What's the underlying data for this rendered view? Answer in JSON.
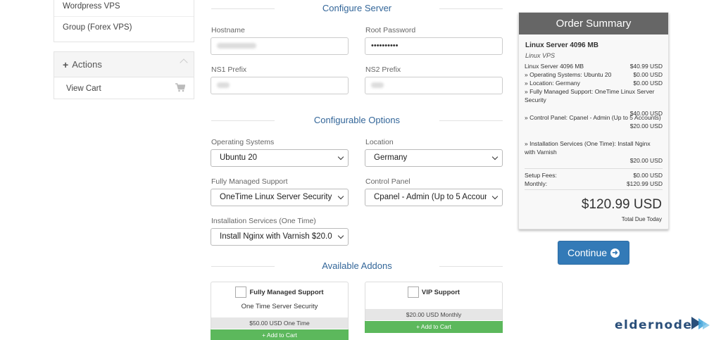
{
  "sidebar": {
    "items": [
      {
        "label": "Wordpress VPS"
      },
      {
        "label": "Group (Forex VPS)"
      }
    ],
    "actions": {
      "title": "Actions",
      "view_cart": "View Cart"
    }
  },
  "configure_server": {
    "title": "Configure Server",
    "hostname_label": "Hostname",
    "root_password_label": "Root Password",
    "root_password_value": "••••••••••",
    "ns1_label": "NS1 Prefix",
    "ns2_label": "NS2 Prefix"
  },
  "configurable_options": {
    "title": "Configurable Options",
    "os_label": "Operating Systems",
    "os_value": "Ubuntu 20",
    "location_label": "Location",
    "location_value": "Germany",
    "support_label": "Fully Managed Support",
    "support_value": "OneTime Linux Server Security $",
    "panel_label": "Control Panel",
    "panel_value": "Cpanel - Admin (Up to 5 Accoun",
    "install_label": "Installation Services (One Time)",
    "install_value": "Install Nginx with Varnish $20.0("
  },
  "addons": {
    "title": "Available Addons",
    "items": [
      {
        "name": "Fully Managed Support",
        "desc": "One Time Server Security",
        "price": "$50.00 USD One Time",
        "button": "+ Add to Cart"
      },
      {
        "name": "VIP Support",
        "desc": "",
        "price": "$20.00 USD Monthly",
        "button": "+ Add to Cart"
      }
    ]
  },
  "summary": {
    "title": "Order Summary",
    "product": "Linux Server 4096 MB",
    "group": "Linux VPS",
    "lines": [
      {
        "label": "Linux Server 4096 MB",
        "amount": "$40.99 USD"
      },
      {
        "label": "» Operating Systems: Ubuntu 20",
        "amount": "$0.00 USD"
      },
      {
        "label": "» Location: Germany",
        "amount": "$0.00 USD"
      },
      {
        "label": "» Fully Managed Support: OneTime Linux Server Security",
        "amount": "$40.00 USD"
      },
      {
        "label": "» Control Panel: Cpanel - Admin (Up to 5 Accounts)",
        "amount": "$20.00 USD"
      },
      {
        "label": "» Installation Services (One Time): Install Nginx with Varnish",
        "amount": "$20.00 USD"
      }
    ],
    "setup_fees_label": "Setup Fees:",
    "setup_fees": "$0.00 USD",
    "monthly_label": "Monthly:",
    "monthly": "$120.99 USD",
    "total": "$120.99 USD",
    "total_label": "Total Due Today"
  },
  "continue_label": "Continue",
  "logo": "eldernode",
  "colors": {
    "accent": "#337ab7",
    "section_title": "#336699",
    "add_to_cart": "#5cb85c",
    "summary_header": "#666666"
  }
}
